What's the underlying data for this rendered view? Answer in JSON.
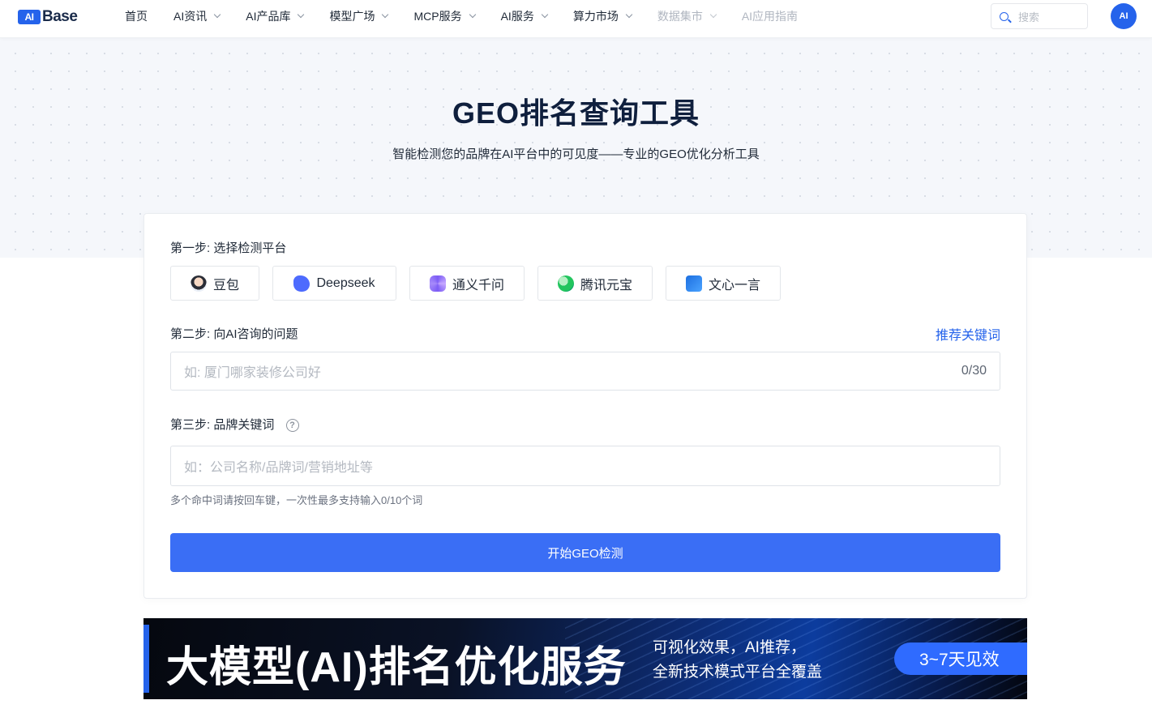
{
  "header": {
    "logo_mark": "AI",
    "logo_text": "Base",
    "nav": [
      {
        "label": "首页",
        "dropdown": false,
        "dim": false
      },
      {
        "label": "AI资讯",
        "dropdown": true,
        "dim": false
      },
      {
        "label": "AI产品库",
        "dropdown": true,
        "dim": false
      },
      {
        "label": "模型广场",
        "dropdown": true,
        "dim": false
      },
      {
        "label": "MCP服务",
        "dropdown": true,
        "dim": false
      },
      {
        "label": "AI服务",
        "dropdown": true,
        "dim": false
      },
      {
        "label": "算力市场",
        "dropdown": true,
        "dim": false
      },
      {
        "label": "数据集市",
        "dropdown": true,
        "dim": true
      },
      {
        "label": "AI应用指南",
        "dropdown": false,
        "dim": true
      }
    ],
    "search_placeholder": "搜索",
    "avatar_text": "AI"
  },
  "hero": {
    "title": "GEO排名查询工具",
    "subtitle": "智能检测您的品牌在AI平台中的可见度——专业的GEO优化分析工具"
  },
  "form": {
    "step1_label": "第一步: 选择检测平台",
    "platforms": [
      {
        "label": "豆包",
        "icon": "doubao-icon"
      },
      {
        "label": "Deepseek",
        "icon": "deepseek-icon"
      },
      {
        "label": "通义千问",
        "icon": "tongyi-icon"
      },
      {
        "label": "腾讯元宝",
        "icon": "yuanbao-icon"
      },
      {
        "label": "文心一言",
        "icon": "wenxin-icon"
      }
    ],
    "step2_label": "第二步: 向AI咨询的问题",
    "recommend_link": "推荐关键词",
    "question_placeholder": "如: 厦门哪家装修公司好",
    "question_counter": "0/30",
    "step3_label": "第三步: 品牌关键词",
    "help_glyph": "?",
    "keyword_placeholder": "如：公司名称/品牌词/营销地址等",
    "keyword_hint": "多个命中词请按回车键，一次性最多支持输入0/10个词",
    "start_button": "开始GEO检测"
  },
  "banner": {
    "title": "大模型(AI)排名优化服务",
    "sub_line1": "可视化效果，AI推荐，",
    "sub_line2": "全新技术模式平台全覆盖",
    "badge": "3~7天见效"
  },
  "colors": {
    "accent": "#3a6ef5",
    "link": "#2563eb",
    "title": "#0f1f3d"
  }
}
